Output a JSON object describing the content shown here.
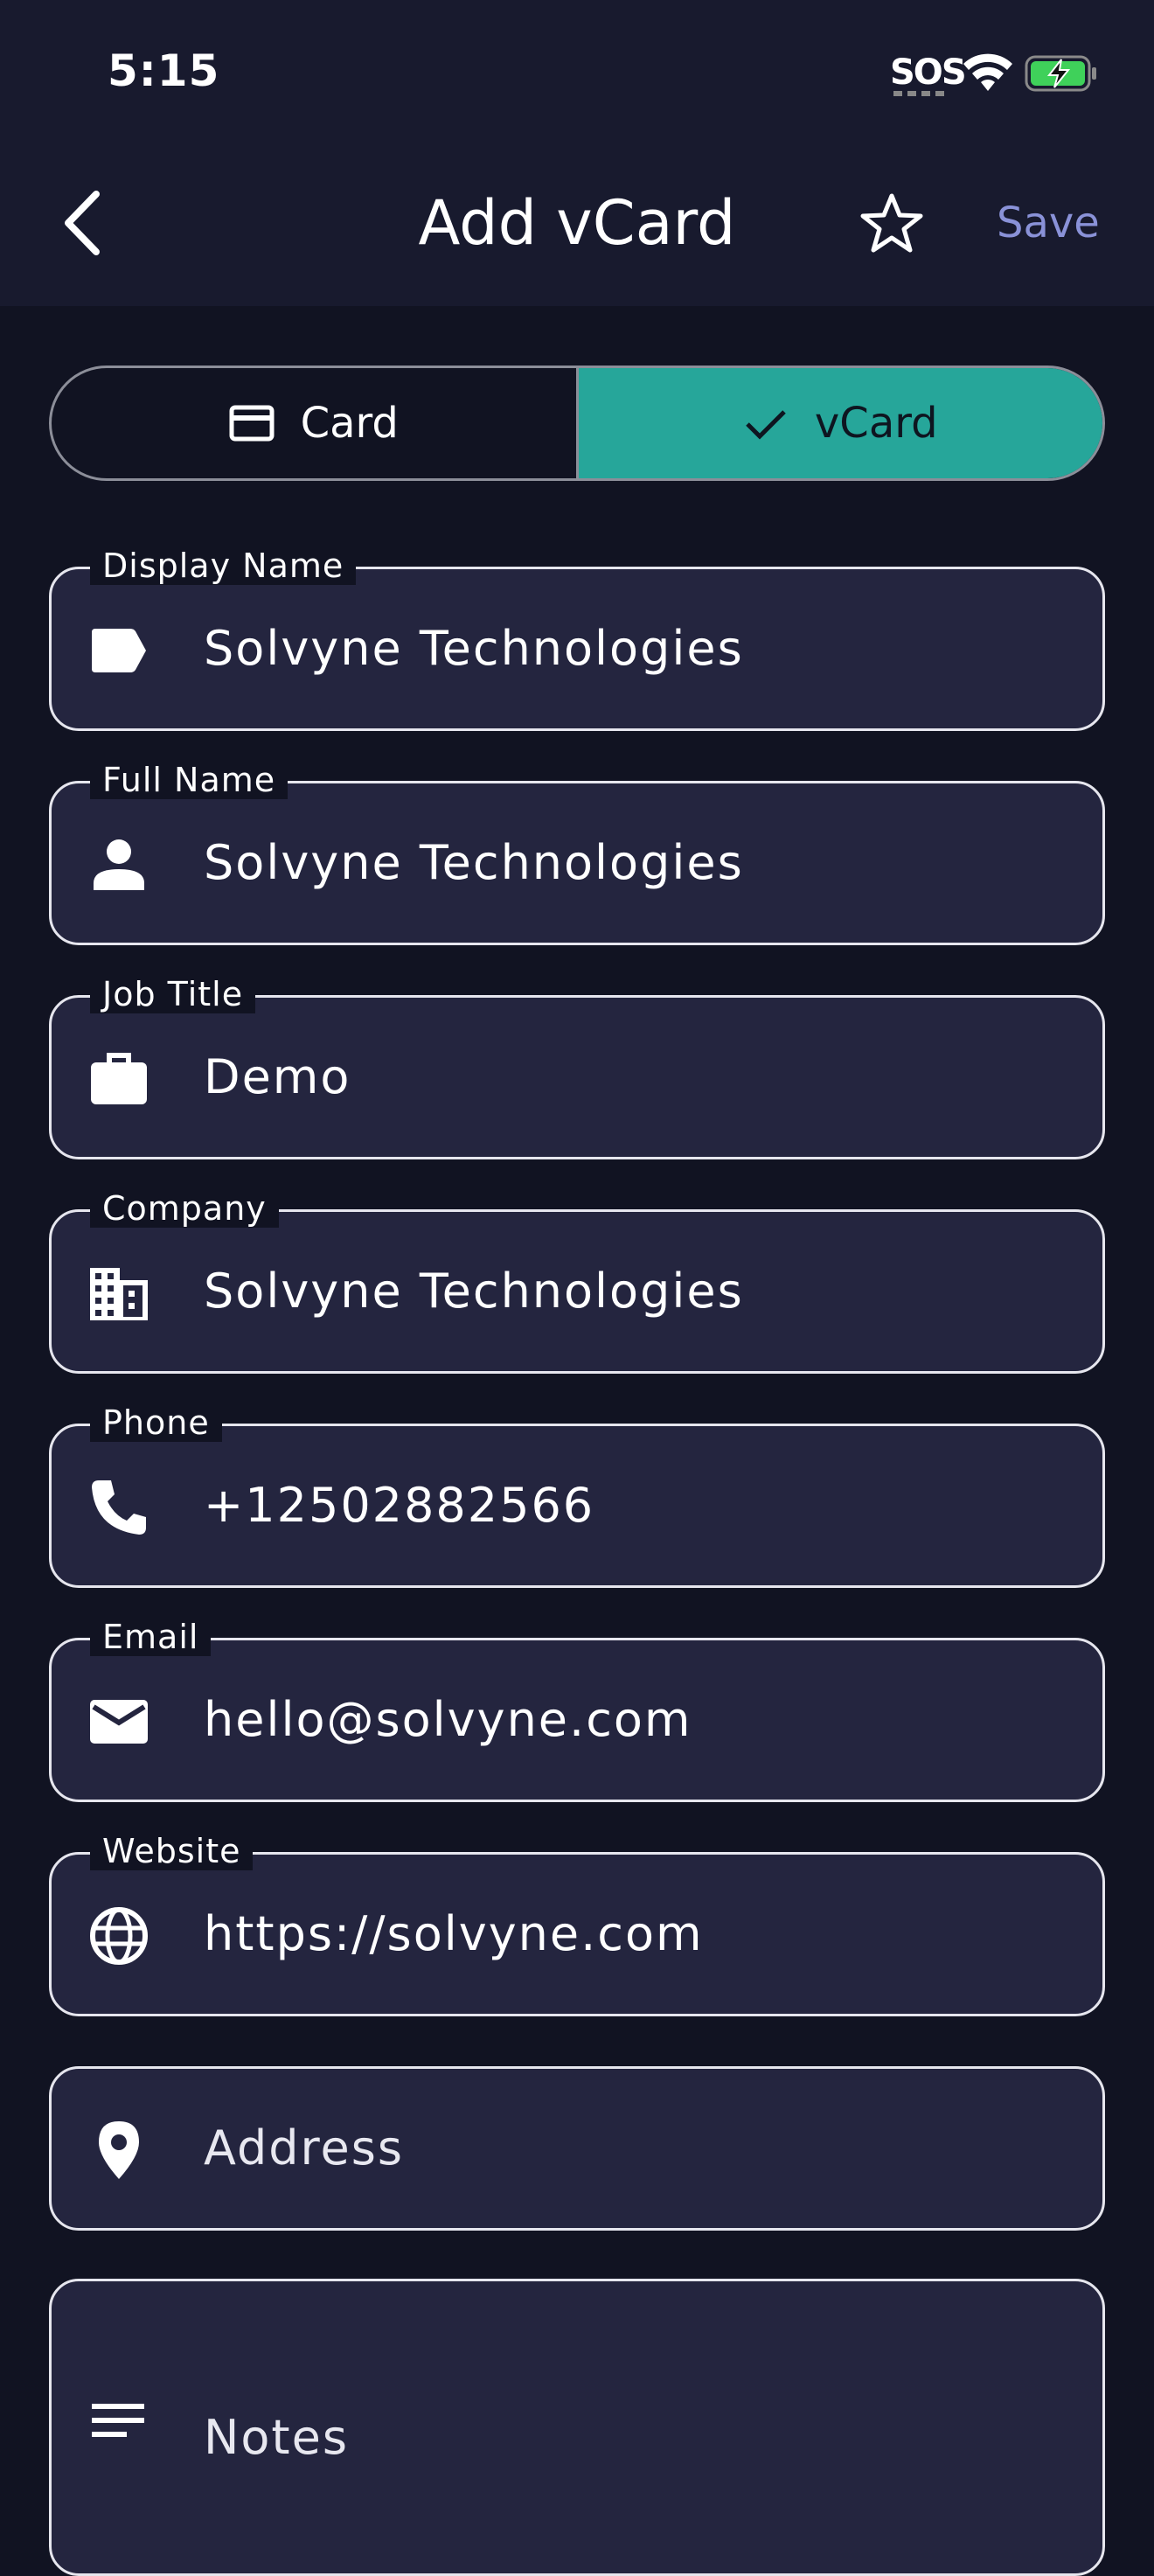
{
  "status_bar": {
    "time": "5:15",
    "sos": "SOS"
  },
  "nav": {
    "title": "Add vCard",
    "save_label": "Save"
  },
  "segmented": {
    "card_label": "Card",
    "vcard_label": "vCard",
    "selected": "vCard",
    "selected_color": "#26a69a"
  },
  "fields": {
    "display_name": {
      "label": "Display Name",
      "value": "Solvyne Technologies",
      "icon": "label-icon"
    },
    "full_name": {
      "label": "Full Name",
      "value": "Solvyne Technologies",
      "icon": "person-icon"
    },
    "job_title": {
      "label": "Job Title",
      "value": "Demo",
      "icon": "briefcase-icon"
    },
    "company": {
      "label": "Company",
      "value": "Solvyne Technologies",
      "icon": "building-icon"
    },
    "phone": {
      "label": "Phone",
      "value": "+12502882566",
      "icon": "phone-icon"
    },
    "email": {
      "label": "Email",
      "value": "hello@solvyne.com",
      "icon": "mail-icon"
    },
    "website": {
      "label": "Website",
      "value": "https://solvyne.com",
      "icon": "globe-icon"
    },
    "address": {
      "placeholder": "Address",
      "icon": "location-pin-icon"
    },
    "notes": {
      "placeholder": "Notes",
      "icon": "notes-icon"
    }
  }
}
